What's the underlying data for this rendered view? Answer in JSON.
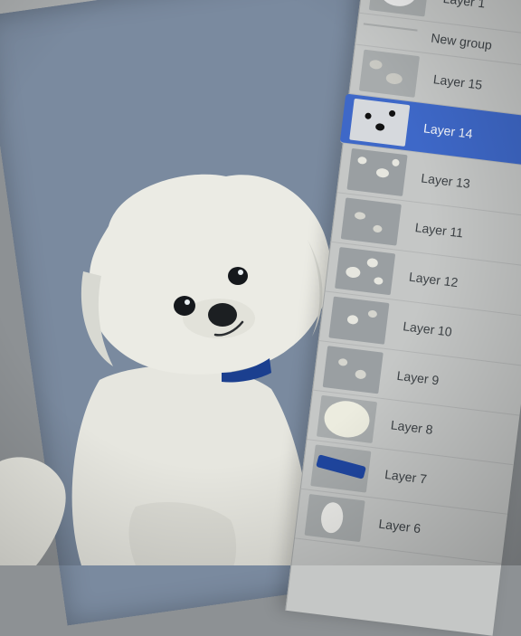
{
  "layers": {
    "items": [
      {
        "label": "Layer 1",
        "kind": "layer",
        "thumb": "sketch"
      },
      {
        "label": "New group",
        "kind": "group"
      },
      {
        "label": "Layer 15",
        "kind": "layer",
        "thumb": "texture"
      },
      {
        "label": "Layer 14",
        "kind": "layer",
        "thumb": "face",
        "selected": true
      },
      {
        "label": "Layer 13",
        "kind": "layer",
        "thumb": "texture"
      },
      {
        "label": "Layer 11",
        "kind": "layer",
        "thumb": "texture"
      },
      {
        "label": "Layer 12",
        "kind": "layer",
        "thumb": "texture"
      },
      {
        "label": "Layer 10",
        "kind": "layer",
        "thumb": "texture"
      },
      {
        "label": "Layer 9",
        "kind": "layer",
        "thumb": "texture"
      },
      {
        "label": "Layer 8",
        "kind": "layer",
        "thumb": "head-fill"
      },
      {
        "label": "Layer 7",
        "kind": "layer",
        "thumb": "collar"
      },
      {
        "label": "Layer 6",
        "kind": "layer",
        "thumb": "fur-tuft"
      }
    ]
  },
  "colors": {
    "canvas_bg": "#7a8a9f",
    "panel_bg": "#c5c7c6",
    "selected_row": "#3e68c8",
    "fur": "#e9e9e2",
    "collar": "#1b3f8f"
  }
}
